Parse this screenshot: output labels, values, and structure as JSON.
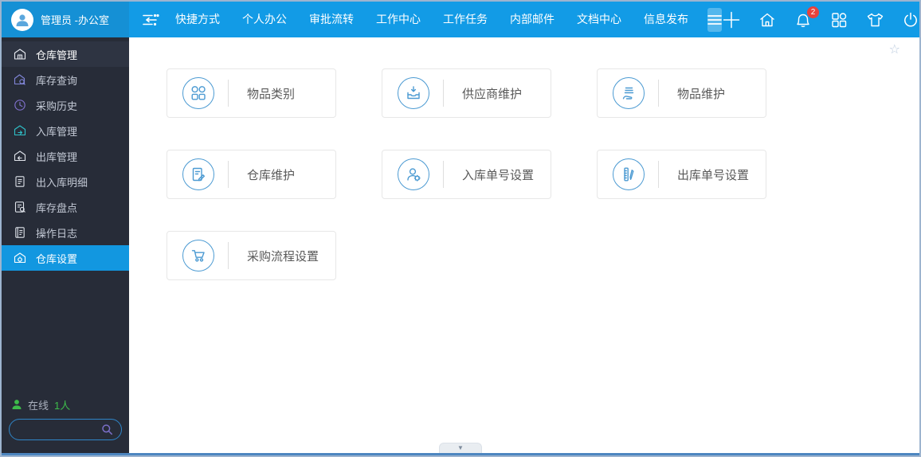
{
  "topbar": {
    "user_name": "管理员 -办公室",
    "menu_items": [
      "快捷方式",
      "个人办公",
      "审批流转",
      "工作中心",
      "工作任务",
      "内部邮件",
      "文档中心",
      "信息发布"
    ],
    "notification_badge": "2"
  },
  "sidebar": {
    "items": [
      {
        "label": "仓库管理"
      },
      {
        "label": "库存查询"
      },
      {
        "label": "采购历史"
      },
      {
        "label": "入库管理"
      },
      {
        "label": "出库管理"
      },
      {
        "label": "出入库明细"
      },
      {
        "label": "库存盘点"
      },
      {
        "label": "操作日志"
      },
      {
        "label": "仓库设置",
        "active": true
      }
    ],
    "online_label": "在线",
    "online_count": "1人",
    "search_value": ""
  },
  "content": {
    "cards": [
      {
        "label": "物品类别",
        "icon": "categories-icon"
      },
      {
        "label": "供应商维护",
        "icon": "supplier-icon"
      },
      {
        "label": "物品维护",
        "icon": "goods-icon"
      },
      {
        "label": "仓库维护",
        "icon": "warehouse-edit-icon"
      },
      {
        "label": "入库单号设置",
        "icon": "inbound-number-icon"
      },
      {
        "label": "出库单号设置",
        "icon": "outbound-number-icon"
      },
      {
        "label": "采购流程设置",
        "icon": "purchase-flow-icon"
      }
    ]
  },
  "icons": {
    "favorite_star": "☆",
    "collapse_arrow": "▼"
  },
  "colors": {
    "topbar_blue": "#129be6",
    "topbar_left_blue": "#1590d5",
    "sidebar_bg": "#272c38",
    "active_item_blue": "#1297e0",
    "card_icon_blue": "#4b9ad2",
    "badge_red": "#e8423c",
    "online_green": "#3dbb4a",
    "search_border_blue": "#2f86c9",
    "bottom_line_blue": "#4d86c0"
  }
}
